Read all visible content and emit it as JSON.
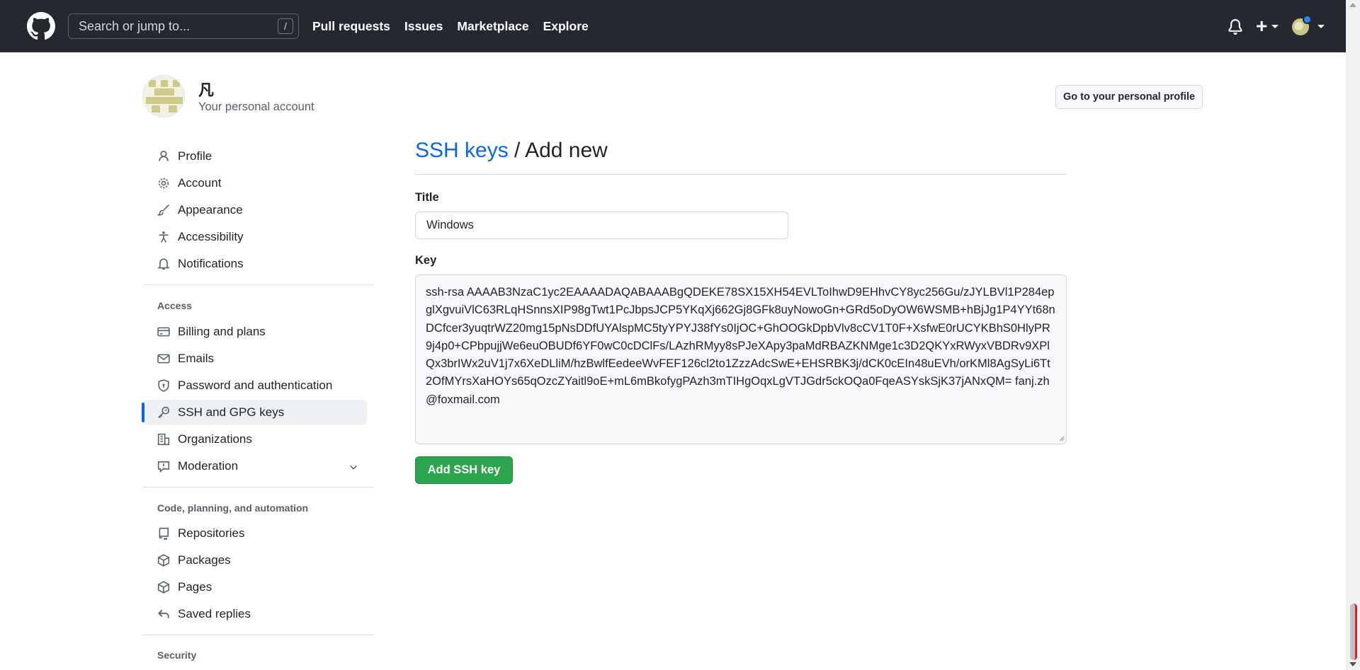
{
  "header": {
    "search_placeholder": "Search or jump to...",
    "search_shortcut": "/",
    "nav": [
      "Pull requests",
      "Issues",
      "Marketplace",
      "Explore"
    ],
    "plus_label": "+"
  },
  "account": {
    "name": "凡",
    "subtitle": "Your personal account",
    "profile_button": "Go to your personal profile"
  },
  "sidebar": {
    "top_items": [
      {
        "label": "Profile",
        "icon": "person-icon"
      },
      {
        "label": "Account",
        "icon": "gear-icon"
      },
      {
        "label": "Appearance",
        "icon": "paintbrush-icon"
      },
      {
        "label": "Accessibility",
        "icon": "accessibility-icon"
      },
      {
        "label": "Notifications",
        "icon": "bell-icon"
      }
    ],
    "access_heading": "Access",
    "access_items": [
      {
        "label": "Billing and plans",
        "icon": "credit-card-icon"
      },
      {
        "label": "Emails",
        "icon": "mail-icon"
      },
      {
        "label": "Password and authentication",
        "icon": "shield-icon"
      },
      {
        "label": "SSH and GPG keys",
        "icon": "key-icon",
        "active": true
      },
      {
        "label": "Organizations",
        "icon": "organization-icon"
      },
      {
        "label": "Moderation",
        "icon": "report-icon"
      }
    ],
    "code_heading": "Code, planning, and automation",
    "code_items": [
      {
        "label": "Repositories",
        "icon": "repo-icon"
      },
      {
        "label": "Packages",
        "icon": "package-icon"
      },
      {
        "label": "Pages",
        "icon": "pages-icon"
      },
      {
        "label": "Saved replies",
        "icon": "reply-icon"
      }
    ],
    "security_heading": "Security"
  },
  "main": {
    "title_link": "SSH keys",
    "title_rest": " / Add new",
    "title_label": "Title",
    "title_value": "Windows",
    "key_label": "Key",
    "key_value": "ssh-rsa AAAAB3NzaC1yc2EAAAADAQABAAABgQDEKE78SX15XH54EVLToIhwD9EHhvCY8yc256Gu/zJYLBVl1P284epglXgvuiVlC63RLqHSnnsXIP98gTwt1PcJbpsJCP5YKqXj662Gj8GFk8uyNowoGn+GRd5oDyOW6WSMB+hBjJg1P4YYt68nDCfcer3yuqtrWZ20mg15pNsDDfUYAlspMC5tyYPYJ38fYs0IjOC+GhOOGkDpbVlv8cCV1T0F+XsfwE0rUCYKBhS0HlyPR9j4p0+CPbpujjWe6euOBUDf6YF0wC0cDClFs/LAzhRMyy8sPJeXApy3paMdRBAZKNMge1c3D2QKYxRWyxVBDRv9XPlQx3brIWx2uV1j7x6XeDLliM/hzBwlfEedeeWvFEF126cl2to1ZzzAdcSwE+EHSRBK3j/dCK0cEIn48uEVh/orKMl8AgSyLi6Tt2OfMYrsXaHOYs65qOzcZYaitl9oE+mL6mBkofygPAzh3mTIHgOqxLgVTJGdr5ckOQa0FqeASYskSjK37jANxQM= fanj.zh@foxmail.com",
    "submit_label": "Add SSH key"
  },
  "colors": {
    "header_bg": "#24292f",
    "link": "#0969da",
    "primary_button": "#2da44e",
    "active_indicator": "#0969da"
  }
}
